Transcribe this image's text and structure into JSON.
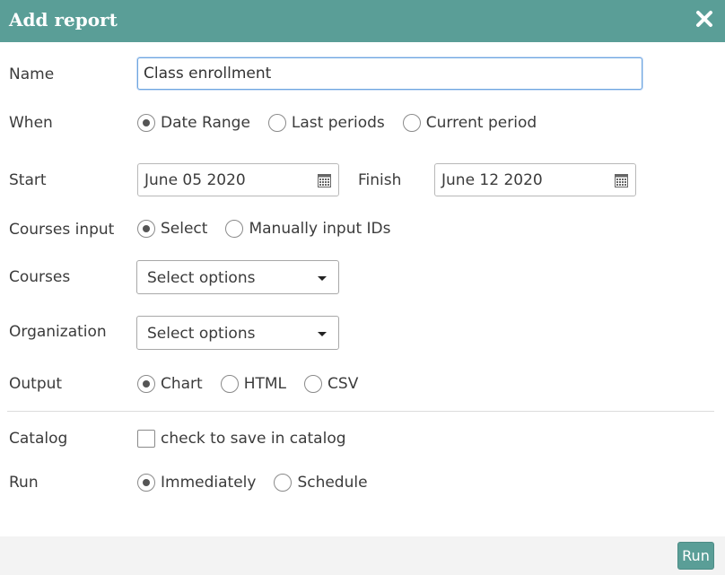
{
  "header": {
    "title": "Add report",
    "close_icon": "close-icon"
  },
  "name": {
    "label": "Name",
    "value": "Class enrollment"
  },
  "when": {
    "label": "When",
    "options": [
      {
        "label": "Date Range",
        "checked": true
      },
      {
        "label": "Last periods",
        "checked": false
      },
      {
        "label": "Current period",
        "checked": false
      }
    ]
  },
  "start": {
    "label": "Start",
    "value": "June 05 2020",
    "icon": "calendar-icon"
  },
  "finish": {
    "label": "Finish",
    "value": "June 12 2020",
    "icon": "calendar-icon"
  },
  "courses_input": {
    "label": "Courses input",
    "options": [
      {
        "label": "Select",
        "checked": true
      },
      {
        "label": "Manually input IDs",
        "checked": false
      }
    ]
  },
  "courses": {
    "label": "Courses",
    "value": "Select options"
  },
  "organization": {
    "label": "Organization",
    "value": "Select options"
  },
  "output": {
    "label": "Output",
    "options": [
      {
        "label": "Chart",
        "checked": true
      },
      {
        "label": "HTML",
        "checked": false
      },
      {
        "label": "CSV",
        "checked": false
      }
    ]
  },
  "catalog": {
    "label": "Catalog",
    "checkbox_label": "check to save in catalog",
    "checked": false
  },
  "run": {
    "label": "Run",
    "options": [
      {
        "label": "Immediately",
        "checked": true
      },
      {
        "label": "Schedule",
        "checked": false
      }
    ]
  },
  "footer": {
    "run_label": "Run"
  },
  "colors": {
    "header": "#5a9e97",
    "run_button": "#5a9e97",
    "footer": "#f3f3f3",
    "input_focus_border": "#6ea6e0"
  }
}
